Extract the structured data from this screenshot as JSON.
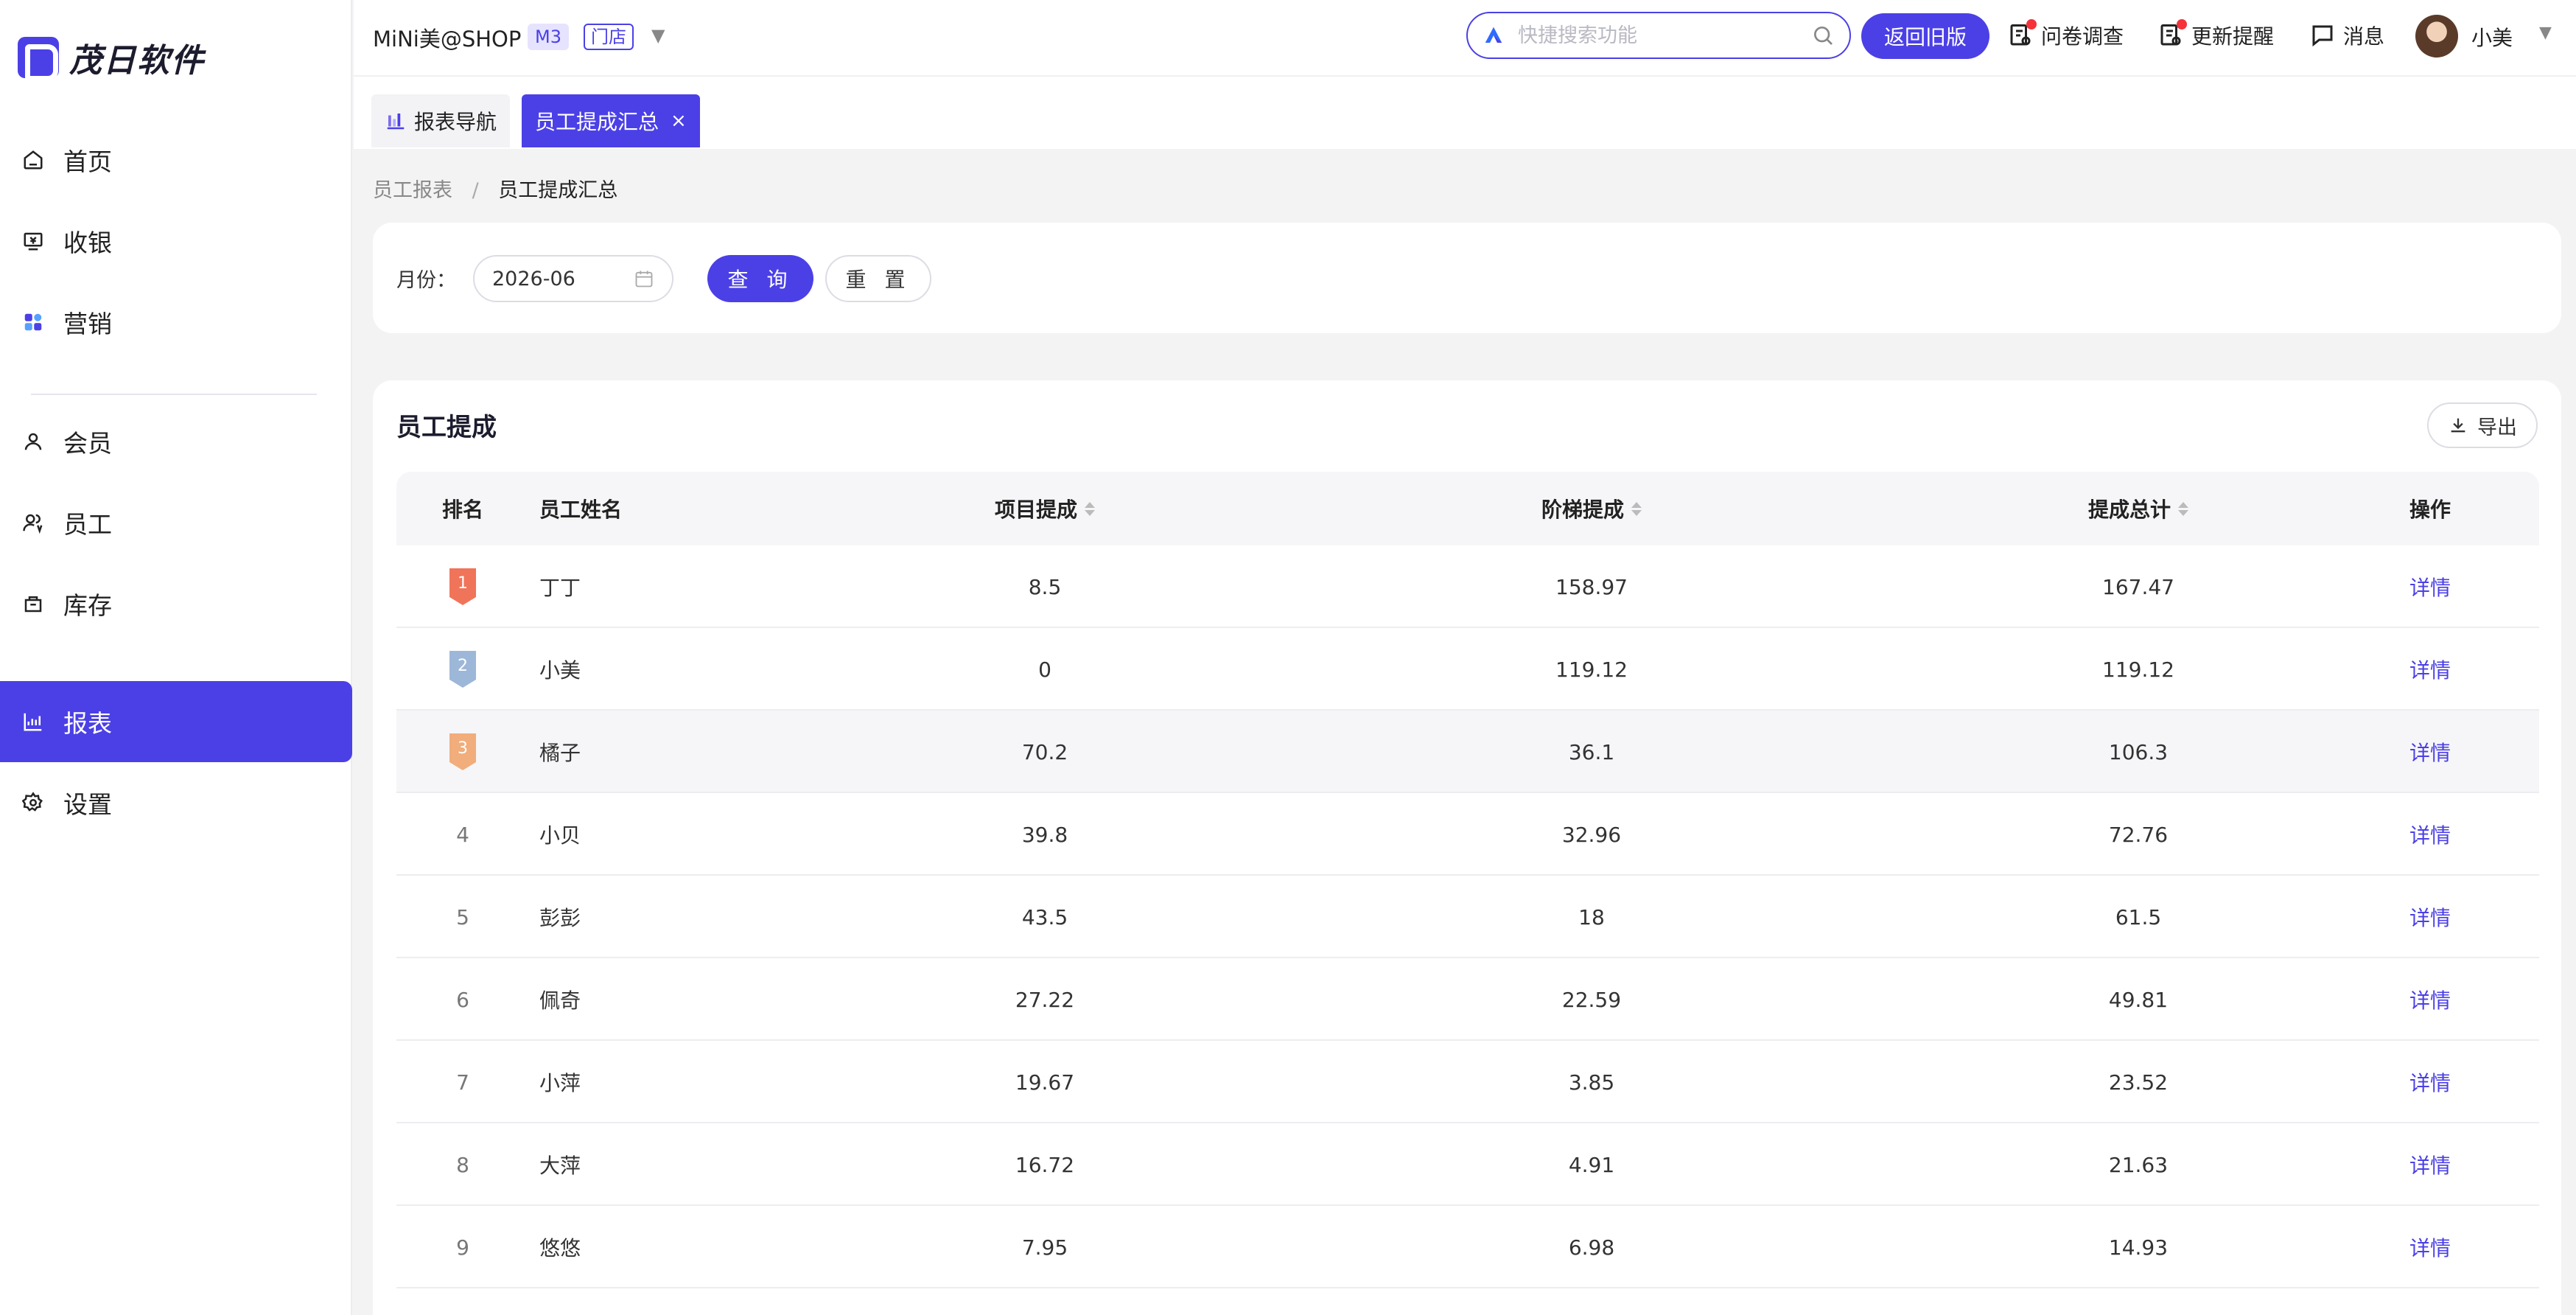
{
  "app": {
    "logo_text": "茂日软件"
  },
  "sidebar": {
    "items": [
      {
        "label": "首页",
        "icon": "home-icon"
      },
      {
        "label": "收银",
        "icon": "cashier-icon"
      },
      {
        "label": "营销",
        "icon": "marketing-icon"
      },
      {
        "label": "会员",
        "icon": "member-icon"
      },
      {
        "label": "员工",
        "icon": "staff-icon"
      },
      {
        "label": "库存",
        "icon": "inventory-icon"
      },
      {
        "label": "报表",
        "icon": "report-icon",
        "active": true
      },
      {
        "label": "设置",
        "icon": "settings-icon"
      }
    ]
  },
  "header": {
    "shop_name": "MiNi美@SHOP",
    "plan_tag": "M3",
    "store_tag": "门店",
    "search_placeholder": "快捷搜索功能",
    "old_version_label": "返回旧版",
    "survey_label": "问卷调查",
    "update_label": "更新提醒",
    "message_label": "消息",
    "user_name": "小美"
  },
  "tabs": [
    {
      "label": "报表导航"
    },
    {
      "label": "员工提成汇总",
      "active": true
    }
  ],
  "breadcrumb": {
    "parent": "员工报表",
    "separator": "/",
    "current": "员工提成汇总"
  },
  "filter": {
    "month_label": "月份：",
    "month_value": "2026-06",
    "query_label": "查 询",
    "reset_label": "重 置"
  },
  "table": {
    "title": "员工提成",
    "export_label": "导出",
    "columns": {
      "rank": "排名",
      "name": "员工姓名",
      "project": "项目提成",
      "step": "阶梯提成",
      "total": "提成总计",
      "op": "操作"
    },
    "rows": [
      {
        "rank": "1",
        "name": "丁丁",
        "project": "8.5",
        "step": "158.97",
        "total": "167.47",
        "op": "详情"
      },
      {
        "rank": "2",
        "name": "小美",
        "project": "0",
        "step": "119.12",
        "total": "119.12",
        "op": "详情"
      },
      {
        "rank": "3",
        "name": "橘子",
        "project": "70.2",
        "step": "36.1",
        "total": "106.3",
        "op": "详情"
      },
      {
        "rank": "4",
        "name": "小贝",
        "project": "39.8",
        "step": "32.96",
        "total": "72.76",
        "op": "详情"
      },
      {
        "rank": "5",
        "name": "彭彭",
        "project": "43.5",
        "step": "18",
        "total": "61.5",
        "op": "详情"
      },
      {
        "rank": "6",
        "name": "佩奇",
        "project": "27.22",
        "step": "22.59",
        "total": "49.81",
        "op": "详情"
      },
      {
        "rank": "7",
        "name": "小萍",
        "project": "19.67",
        "step": "3.85",
        "total": "23.52",
        "op": "详情"
      },
      {
        "rank": "8",
        "name": "大萍",
        "project": "16.72",
        "step": "4.91",
        "total": "21.63",
        "op": "详情"
      },
      {
        "rank": "9",
        "name": "悠悠",
        "project": "7.95",
        "step": "6.98",
        "total": "14.93",
        "op": "详情"
      }
    ]
  },
  "colors": {
    "accent": "#4b40e6",
    "gold": "#f0745a",
    "silver": "#9db7d8",
    "bronze": "#f1ad7b"
  }
}
